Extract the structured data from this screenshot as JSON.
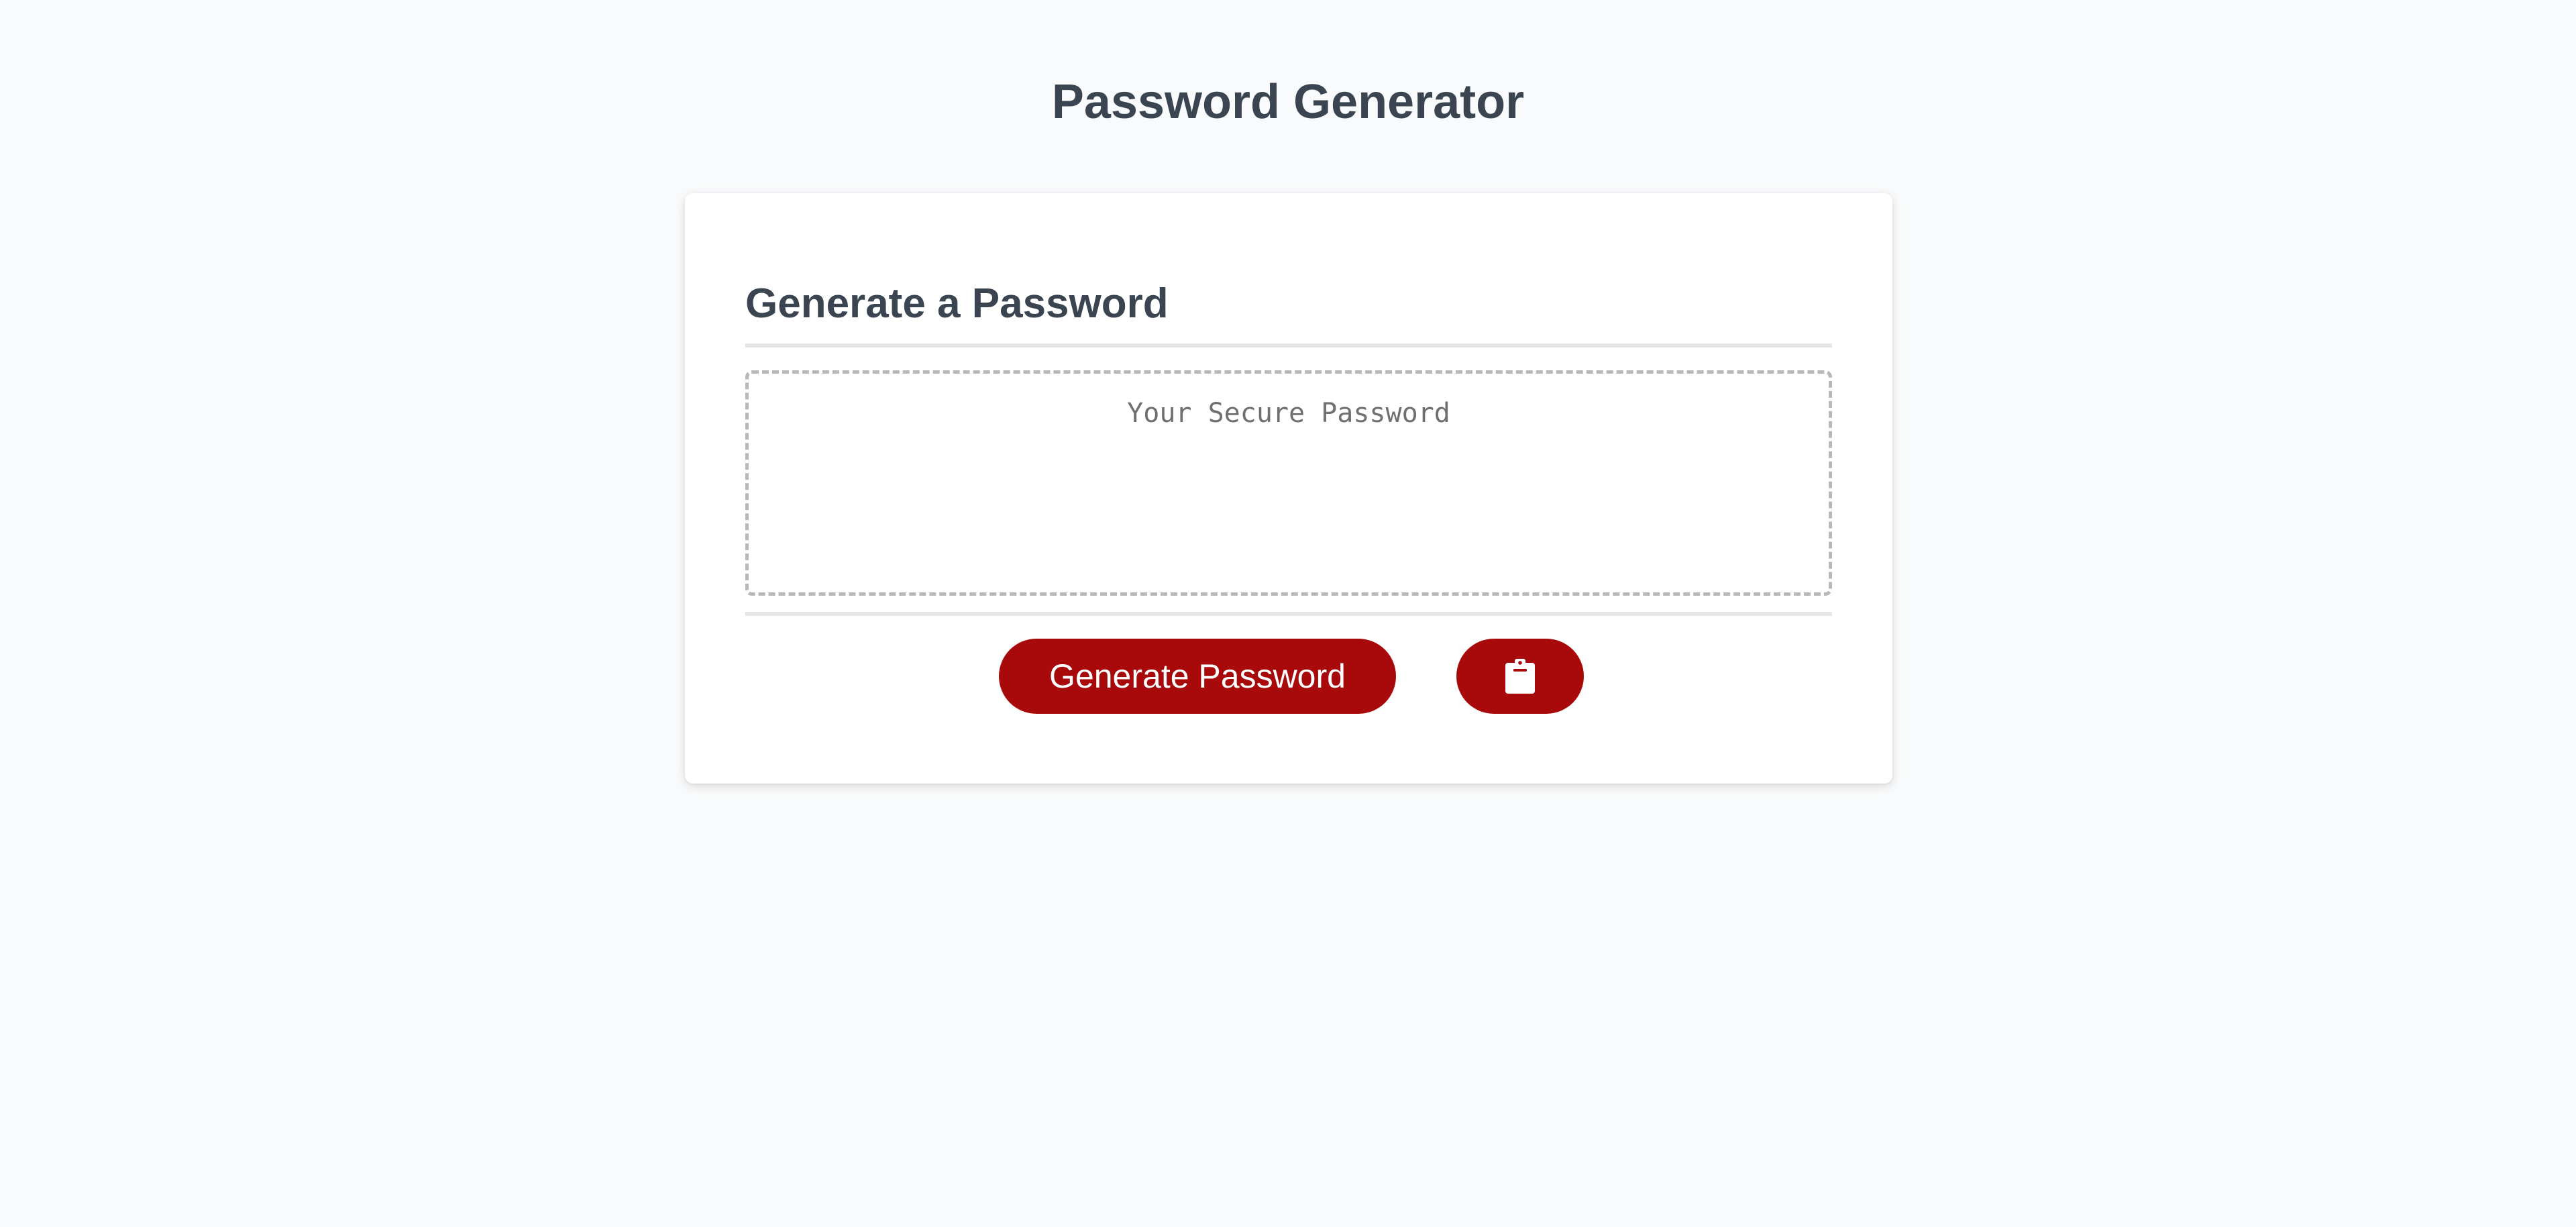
{
  "page": {
    "title": "Password Generator"
  },
  "card": {
    "heading": "Generate a Password",
    "password_field": {
      "value": "",
      "placeholder": "Your Secure Password"
    },
    "generate_button_label": "Generate Password",
    "copy_button_icon": "clipboard-icon"
  },
  "colors": {
    "background": "#f9fafb",
    "heading_text": "#3a4551",
    "button_accent": "#a80a0b",
    "button_text": "#ffffff"
  }
}
